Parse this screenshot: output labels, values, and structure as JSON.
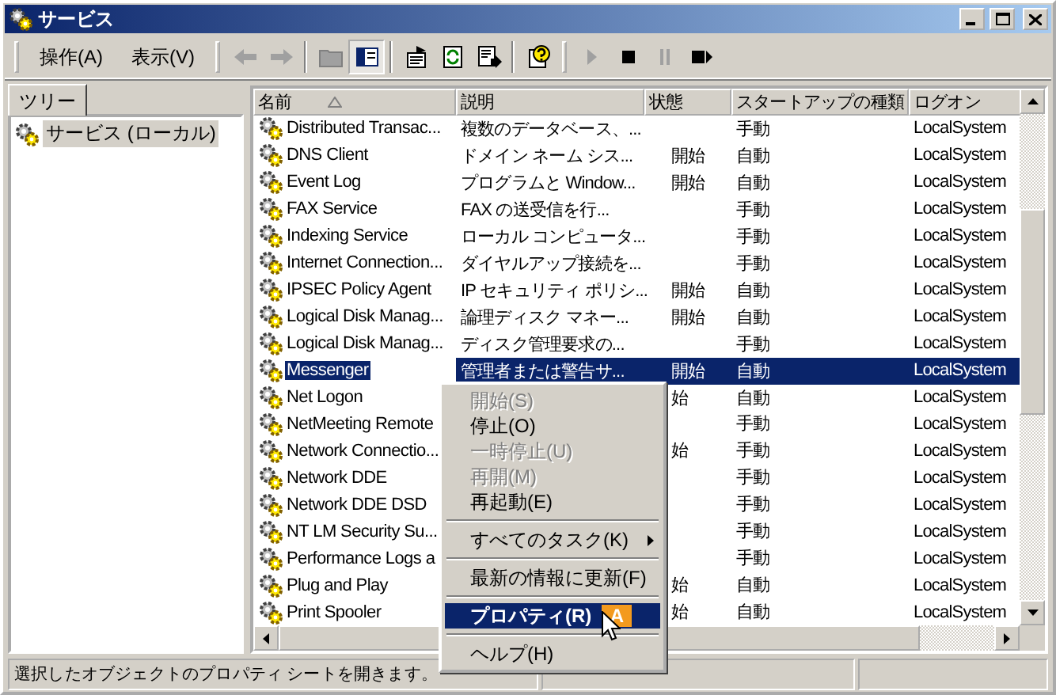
{
  "window": {
    "title": "サービス"
  },
  "menu": [
    {
      "label": "操作(A)"
    },
    {
      "label": "表示(V)"
    }
  ],
  "toolbar": [
    {
      "kind": "back",
      "disabled": true,
      "pressed": false
    },
    {
      "kind": "forward",
      "disabled": true,
      "pressed": false
    },
    {
      "kind": "sep"
    },
    {
      "kind": "up",
      "disabled": true,
      "pressed": false
    },
    {
      "kind": "tree",
      "disabled": false,
      "pressed": true
    },
    {
      "kind": "sep"
    },
    {
      "kind": "properties",
      "disabled": false,
      "pressed": false
    },
    {
      "kind": "refresh",
      "disabled": false,
      "pressed": false
    },
    {
      "kind": "export",
      "disabled": false,
      "pressed": false
    },
    {
      "kind": "sep"
    },
    {
      "kind": "help",
      "disabled": false,
      "pressed": false
    },
    {
      "kind": "grip"
    },
    {
      "kind": "play",
      "disabled": true,
      "pressed": false
    },
    {
      "kind": "stop",
      "disabled": false,
      "pressed": false
    },
    {
      "kind": "pause",
      "disabled": true,
      "pressed": false
    },
    {
      "kind": "restart",
      "disabled": false,
      "pressed": false
    }
  ],
  "tree_tab": {
    "label": "ツリー",
    "selected": true
  },
  "tree": {
    "items": [
      {
        "label": "サービス (ローカル)",
        "selected": true
      }
    ]
  },
  "table": {
    "columns": [
      {
        "label": "名前",
        "sorted": true
      },
      {
        "label": "説明",
        "sorted": false
      },
      {
        "label": "状態",
        "sorted": false
      },
      {
        "label": "スタートアップの種類",
        "sorted": false
      },
      {
        "label": "ログオン",
        "sorted": false
      }
    ],
    "rows": [
      {
        "name": "Distributed Transac...",
        "description": "複数のデータベース、...",
        "state": "",
        "startup": "手動",
        "logon": "LocalSystem",
        "selected": false
      },
      {
        "name": "DNS Client",
        "description": "ドメイン ネーム シス...",
        "state": "開始",
        "startup": "自動",
        "logon": "LocalSystem",
        "selected": false
      },
      {
        "name": "Event Log",
        "description": "プログラムと Window...",
        "state": "開始",
        "startup": "自動",
        "logon": "LocalSystem",
        "selected": false
      },
      {
        "name": "FAX Service",
        "description": "FAX の送受信を行...",
        "state": "",
        "startup": "手動",
        "logon": "LocalSystem",
        "selected": false
      },
      {
        "name": "Indexing Service",
        "description": "ローカル コンピュータ...",
        "state": "",
        "startup": "手動",
        "logon": "LocalSystem",
        "selected": false
      },
      {
        "name": "Internet Connection...",
        "description": "ダイヤルアップ接続を...",
        "state": "",
        "startup": "手動",
        "logon": "LocalSystem",
        "selected": false
      },
      {
        "name": "IPSEC Policy Agent",
        "description": "IP セキュリティ ポリシ...",
        "state": "開始",
        "startup": "自動",
        "logon": "LocalSystem",
        "selected": false
      },
      {
        "name": "Logical Disk Manag...",
        "description": "論理ディスク マネー...",
        "state": "開始",
        "startup": "自動",
        "logon": "LocalSystem",
        "selected": false
      },
      {
        "name": "Logical Disk Manag...",
        "description": "ディスク管理要求の...",
        "state": "",
        "startup": "手動",
        "logon": "LocalSystem",
        "selected": false
      },
      {
        "name": "Messenger",
        "description": "管理者または警告サ...",
        "state": "開始",
        "startup": "自動",
        "logon": "LocalSystem",
        "selected": true
      },
      {
        "name": "Net Logon",
        "state": "始",
        "startup": "自動",
        "logon": "LocalSystem",
        "selected": false
      },
      {
        "name": "NetMeeting Remote",
        "startup": "手動",
        "logon": "LocalSystem",
        "selected": false
      },
      {
        "name": "Network Connectio...",
        "state": "始",
        "startup": "手動",
        "logon": "LocalSystem",
        "selected": false
      },
      {
        "name": "Network DDE",
        "startup": "手動",
        "logon": "LocalSystem",
        "selected": false
      },
      {
        "name": "Network DDE DSD",
        "startup": "手動",
        "logon": "LocalSystem",
        "selected": false
      },
      {
        "name": "NT LM Security Su...",
        "startup": "手動",
        "logon": "LocalSystem",
        "selected": false
      },
      {
        "name": "Performance Logs a",
        "startup": "手動",
        "logon": "LocalSystem",
        "selected": false
      },
      {
        "name": "Plug and Play",
        "state": "始",
        "startup": "自動",
        "logon": "LocalSystem",
        "selected": false
      },
      {
        "name": "Print Spooler",
        "state": "始",
        "startup": "自動",
        "logon": "LocalSystem",
        "selected": false
      }
    ]
  },
  "context_menu": {
    "items": [
      {
        "kind": "item",
        "label": "開始(S)",
        "disabled": true,
        "selected": false
      },
      {
        "kind": "item",
        "label": "停止(O)",
        "disabled": false,
        "selected": false
      },
      {
        "kind": "item",
        "label": "一時停止(U)",
        "disabled": true,
        "selected": false
      },
      {
        "kind": "item",
        "label": "再開(M)",
        "disabled": true,
        "selected": false
      },
      {
        "kind": "item",
        "label": "再起動(E)",
        "disabled": false,
        "selected": false
      },
      {
        "kind": "separator"
      },
      {
        "kind": "submenu",
        "label": "すべてのタスク(K)",
        "disabled": false,
        "selected": false
      },
      {
        "kind": "separator"
      },
      {
        "kind": "item",
        "label": "最新の情報に更新(F)",
        "disabled": false,
        "selected": false
      },
      {
        "kind": "separator"
      },
      {
        "kind": "item",
        "label": "プロパティ(R)",
        "disabled": false,
        "selected": true,
        "badge": "A"
      },
      {
        "kind": "separator"
      },
      {
        "kind": "item",
        "label": "ヘルプ(H)",
        "disabled": false,
        "selected": false
      }
    ]
  },
  "status_bar": {
    "text": "選択したオブジェクトのプロパティ シートを開きます。"
  }
}
